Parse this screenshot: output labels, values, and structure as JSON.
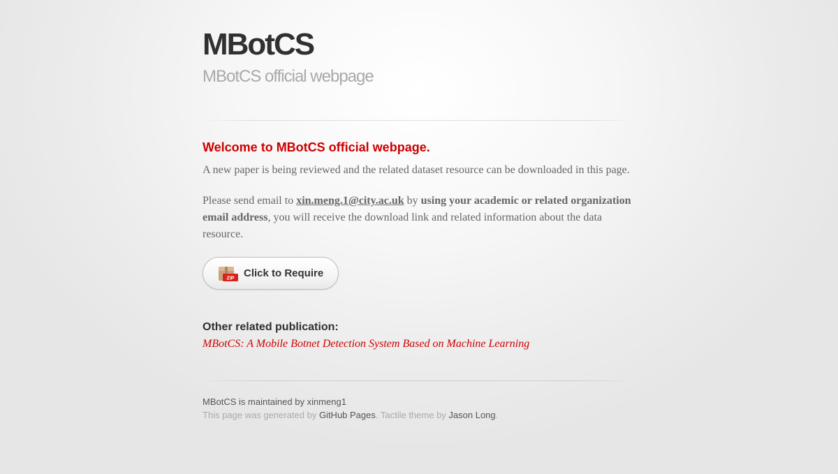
{
  "header": {
    "title": "MBotCS",
    "subtitle": "MBotCS official webpage"
  },
  "main": {
    "welcome_heading": "Welcome to MBotCS official webpage.",
    "paragraph1": "A new paper is being reviewed and the related dataset resource can be downloaded in this page.",
    "paragraph2": {
      "prefix": "Please send email to ",
      "email": "xin.meng.1@city.ac.uk",
      "by": " by ",
      "emphasis": "using your academic or related organization email address",
      "suffix": ", you will receive the download link and related information about the data resource."
    },
    "require_button": {
      "label": "Click to Require",
      "icon": "zip-archive-icon",
      "icon_text": "ZIP"
    },
    "other_publication_heading": "Other related publication:",
    "publication_link": "MBotCS: A Mobile Botnet Detection System Based on Machine Learning"
  },
  "footer": {
    "maintained_by": "MBotCS is maintained by xinmeng1",
    "generated_prefix": "This page was generated by ",
    "github_pages": "GitHub Pages",
    "theme_text": ". Tactile theme by ",
    "author": "Jason Long",
    "end": "."
  },
  "colors": {
    "accent": "#cc0000",
    "title": "#303030",
    "subtitle": "#a9a9a9",
    "body_text": "#666666"
  }
}
